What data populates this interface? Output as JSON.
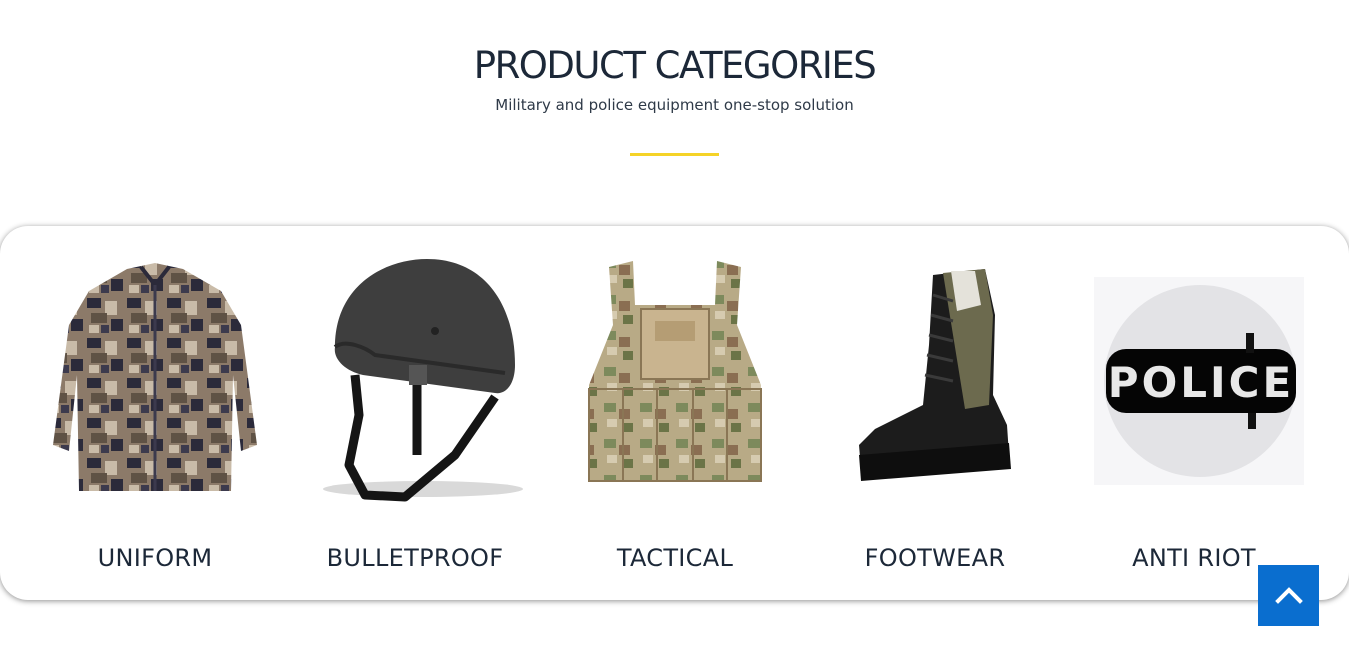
{
  "header": {
    "title": "PRODUCT CATEGORIES",
    "subtitle": "Military and police equipment one-stop solution"
  },
  "colors": {
    "divider": "#f5d327",
    "back_to_top": "#0a6ecf",
    "text": "#1c2838"
  },
  "categories": [
    {
      "label": "UNIFORM",
      "icon": "camo-jacket-image"
    },
    {
      "label": "BULLETPROOF",
      "icon": "ballistic-helmet-image"
    },
    {
      "label": "TACTICAL",
      "icon": "tactical-vest-image"
    },
    {
      "label": "FOOTWEAR",
      "icon": "combat-boot-image"
    },
    {
      "label": "ANTI RIOT",
      "icon": "riot-shield-image",
      "image_text": "POLICE"
    }
  ],
  "back_to_top": {
    "icon": "chevron-up-icon"
  }
}
